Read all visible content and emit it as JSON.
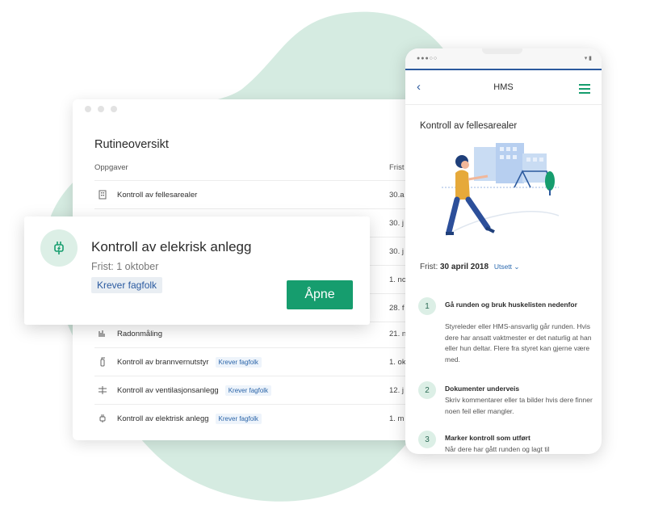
{
  "colors": {
    "accent_green": "#169d6e",
    "blob": "#d5ebe1",
    "nav_blue": "#2c5a9e",
    "tag_blue": "#2a64a8"
  },
  "desktop": {
    "title": "Rutineoversikt",
    "col_tasks": "Oppgaver",
    "col_due": "Frist",
    "rows": [
      {
        "icon": "building-icon",
        "name": "Kontroll av fellesarealer",
        "tag": "",
        "due": "30.a"
      },
      {
        "icon": "",
        "name": "",
        "tag": "",
        "due": "30. j"
      },
      {
        "icon": "",
        "name": "",
        "tag": "",
        "due": "30. j"
      },
      {
        "icon": "",
        "name": "",
        "tag": "",
        "due": "1. no"
      },
      {
        "icon": "",
        "name": "",
        "tag": "",
        "due": "28. f"
      },
      {
        "icon": "radon-icon",
        "name": "Radonmåling",
        "tag": "",
        "due": "21. n"
      },
      {
        "icon": "fire-extinguisher-icon",
        "name": "Kontroll av brannvernutstyr",
        "tag": "Krever fagfolk",
        "due": "1. ok"
      },
      {
        "icon": "ventilation-icon",
        "name": "Kontroll av ventilasjonsanlegg",
        "tag": "Krever fagfolk",
        "due": "12. j"
      },
      {
        "icon": "plug-icon",
        "name": "Kontroll av elektrisk anlegg",
        "tag": "Krever fagfolk",
        "due": "1. m"
      }
    ]
  },
  "popup": {
    "icon": "plug-icon",
    "title": "Kontroll av elekrisk anlegg",
    "due": "Frist: 1 oktober",
    "tag": "Krever fagfolk",
    "open_label": "Åpne"
  },
  "phone": {
    "status_signal": "●●●○○",
    "status_battery": "▾ ▮",
    "back": "‹",
    "title": "HMS",
    "heading": "Kontroll av fellesarealer",
    "due_prefix": "Frist: ",
    "due_date": "30 april 2018",
    "postpone": "Utsett ⌄",
    "steps": [
      {
        "num": "1",
        "title": "Gå runden og bruk huskelisten nedenfor",
        "body": "Styreleder eller HMS-ansvarlig går runden. Hvis dere har ansatt vaktmester er det naturlig at han eller hun deltar. Flere fra styret kan gjerne være med."
      },
      {
        "num": "2",
        "title": "Dokumenter underveis",
        "body": "Skriv kommentarer eller ta bilder hvis dere finner noen feil eller mangler."
      },
      {
        "num": "3",
        "title": "Marker kontroll som utført",
        "body": "Når dere har gått runden og lagt til"
      }
    ]
  }
}
